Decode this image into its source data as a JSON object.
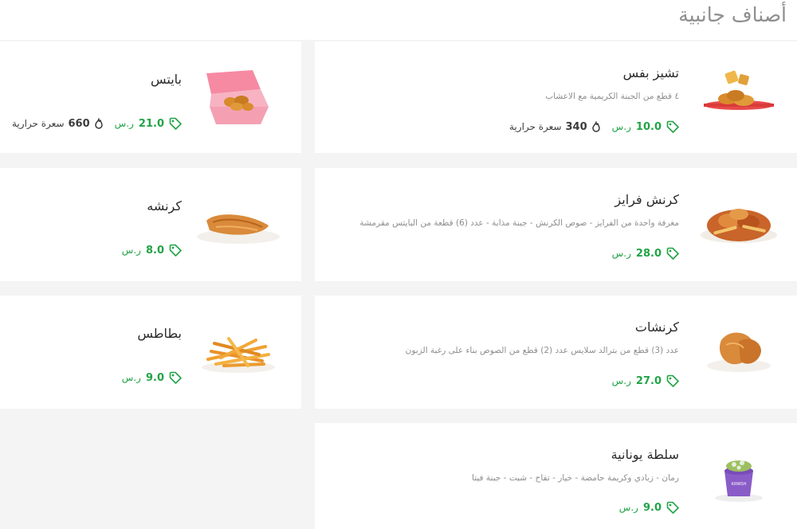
{
  "section": {
    "title": "أصناف جانبية"
  },
  "currency": "ر.س",
  "items": [
    {
      "name": "تشيز بفس",
      "desc": "٤ قطع من الجبنة الكريمية مع الاعشاب",
      "price": "10.0",
      "calories": "340",
      "calories_label": "سعرة حرارية",
      "image": "cheese-puffs-image"
    },
    {
      "name": "بايتس",
      "desc": "",
      "price": "21.0",
      "calories": "660",
      "calories_label": "سعرة حرارية",
      "image": "bites-box-image"
    },
    {
      "name": "كرنش فرايز",
      "desc": "مغرفة واحدة من الفرايز - صوص الكرنش - جبنة مذابة - عدد (6) قطعة من البايتس مقرمشة",
      "price": "28.0",
      "image": "crunch-fries-image"
    },
    {
      "name": "كرنشه",
      "desc": "",
      "price": "8.0",
      "image": "crunsha-image"
    },
    {
      "name": "كرنشات",
      "desc": "عدد (3) قطع من بترالد سلايس عدد (2) قطع من الصوص بناء على رغبة الزبون",
      "price": "27.0",
      "image": "crunchat-image"
    },
    {
      "name": "بطاطس",
      "desc": "",
      "price": "9.0",
      "image": "fries-image"
    },
    {
      "name": "سلطة يونانية",
      "desc": "رمان - زبادي وكريمة حامضة - خيار - تفاح - شبت - جبنة فيتا",
      "price": "9.0",
      "image": "greek-salad-image",
      "cup_label": "KRWSH"
    }
  ],
  "colors": {
    "price": "#22a447",
    "card": "#ffffff",
    "background": "#f4f4f4",
    "title": "#8f8f8f"
  }
}
